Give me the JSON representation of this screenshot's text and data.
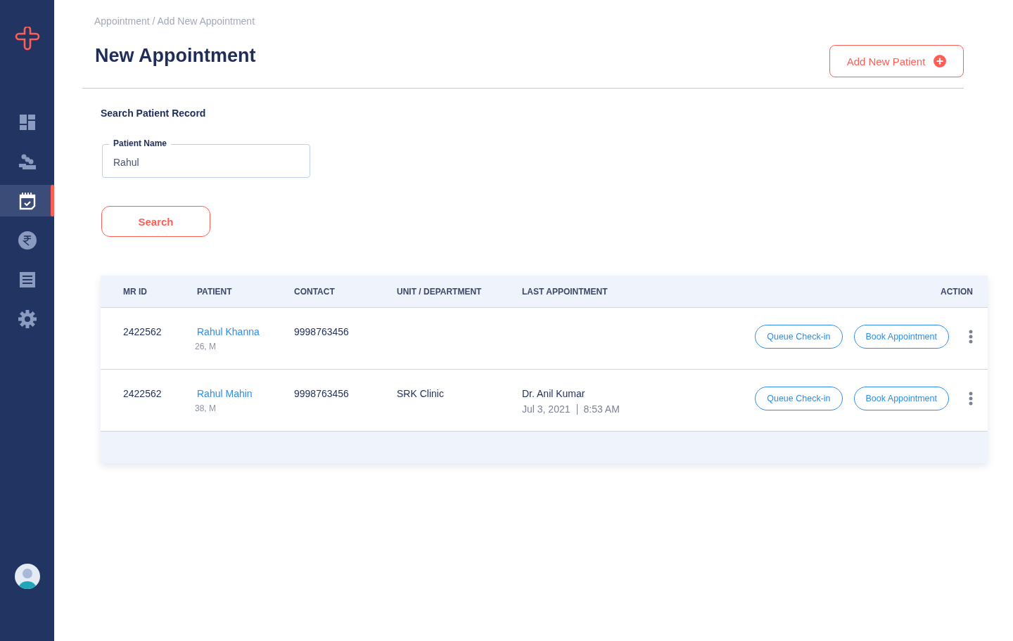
{
  "sidebar": {
    "items": [
      {
        "selected": false
      },
      {
        "selected": false
      },
      {
        "selected": true
      },
      {
        "selected": false
      },
      {
        "selected": false
      },
      {
        "selected": false
      }
    ]
  },
  "breadcrumb": "Appointment / Add New Appointment",
  "title": "New Appointment",
  "add_button": "Add New Patient",
  "search_section": {
    "heading": "Search Patient Record",
    "field": {
      "label": "Patient Name",
      "value": "Rahul"
    },
    "button": "Search"
  },
  "table": {
    "columns": [
      "MR ID",
      "PATIENT",
      "CONTACT",
      "UNIT / DEPARTMENT",
      "LAST APPOINTMENT",
      "ACTION"
    ],
    "rows": [
      {
        "mr_id": "2422562",
        "patient": "Rahul Khanna",
        "age_sex": "26, M",
        "contact": "9998763456",
        "actions": [
          "Queue Check-in",
          "Book Appointment"
        ]
      },
      {
        "mr_id": "2422562",
        "patient": "Rahul Mahin",
        "age_sex": "38, M",
        "contact": "9998763456",
        "unit": "SRK Clinic",
        "last_doctor": "Dr. Anil Kumar",
        "last_date": "Jul 3, 2021",
        "last_time": "8:53 AM",
        "actions": [
          "Queue Check-in",
          "Book Appointment"
        ]
      }
    ]
  }
}
